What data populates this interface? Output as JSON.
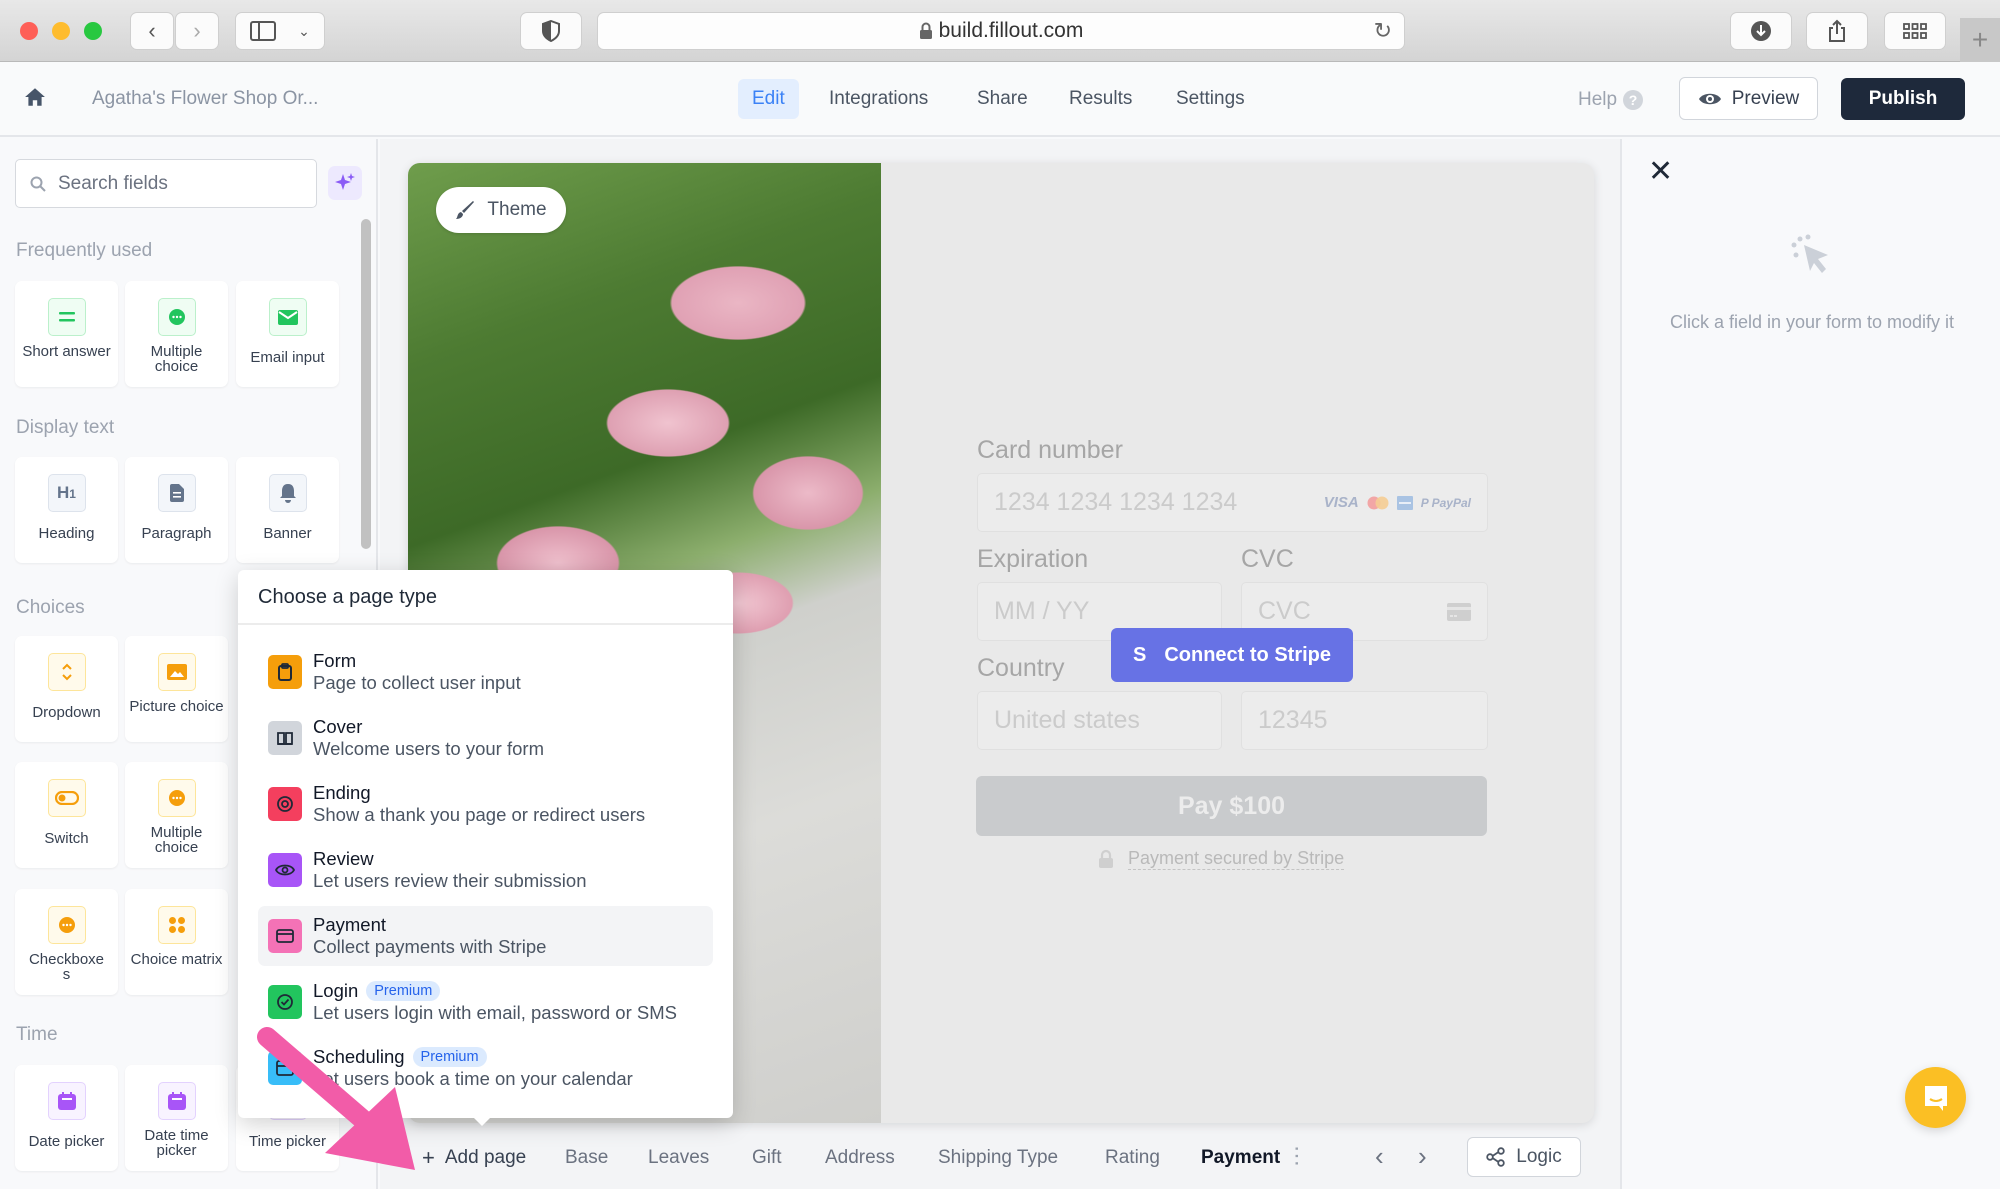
{
  "browser": {
    "url": "build.fillout.com",
    "icons": [
      "back-icon",
      "forward-icon",
      "sidebar-icon",
      "chevron-down-icon",
      "shield-icon",
      "lock-icon",
      "reload-icon",
      "download-icon",
      "share-icon",
      "grid-icon",
      "plus-icon"
    ]
  },
  "header": {
    "form_title": "Agatha's Flower Shop Or...",
    "tabs": [
      {
        "label": "Edit",
        "active": true
      },
      {
        "label": "Integrations",
        "active": false
      },
      {
        "label": "Share",
        "active": false
      },
      {
        "label": "Results",
        "active": false
      },
      {
        "label": "Settings",
        "active": false
      }
    ],
    "help_label": "Help",
    "preview_label": "Preview",
    "publish_label": "Publish",
    "accent_color": "#3b82f6"
  },
  "sidebar": {
    "search_placeholder": "Search fields",
    "sections": [
      {
        "label": "Frequently used",
        "items": [
          {
            "label": "Short answer",
            "icon": "short-answer-icon",
            "color": "#22c55e"
          },
          {
            "label": "Multiple choice",
            "icon": "multiple-choice-icon",
            "color": "#22c55e"
          },
          {
            "label": "Email input",
            "icon": "email-icon",
            "color": "#22c55e"
          }
        ]
      },
      {
        "label": "Display text",
        "items": [
          {
            "label": "Heading",
            "icon": "heading-icon",
            "color": "#64748b"
          },
          {
            "label": "Paragraph",
            "icon": "paragraph-icon",
            "color": "#64748b"
          },
          {
            "label": "Banner",
            "icon": "bell-icon",
            "color": "#64748b"
          }
        ]
      },
      {
        "label": "Choices",
        "items": [
          {
            "label": "Dropdown",
            "icon": "dropdown-icon",
            "color": "#f59e0b"
          },
          {
            "label": "Picture choice",
            "icon": "picture-icon",
            "color": "#f59e0b"
          },
          {
            "label": "Switch",
            "icon": "switch-icon",
            "color": "#f59e0b"
          },
          {
            "label": "Multiple choice",
            "icon": "multiple-choice-icon",
            "color": "#f59e0b"
          },
          {
            "label": "Checkboxes",
            "icon": "checkboxes-icon",
            "color": "#f59e0b"
          },
          {
            "label": "Choice matrix",
            "icon": "matrix-icon",
            "color": "#f59e0b"
          }
        ]
      },
      {
        "label": "Time",
        "items": [
          {
            "label": "Date picker",
            "icon": "calendar-icon",
            "color": "#a855f7"
          },
          {
            "label": "Date time picker",
            "icon": "calendar-icon",
            "color": "#a855f7"
          },
          {
            "label": "Time picker",
            "icon": "calendar-icon",
            "color": "#a855f7"
          }
        ]
      }
    ]
  },
  "canvas": {
    "theme_label": "Theme",
    "payment_form": {
      "card_number_label": "Card number",
      "card_number_placeholder": "1234 1234 1234 1234",
      "card_brands": [
        "VISA",
        "Mastercard",
        "Amex",
        "PayPal"
      ],
      "expiration_label": "Expiration",
      "expiration_placeholder": "MM / YY",
      "cvc_label": "CVC",
      "cvc_placeholder": "CVC",
      "country_label": "Country",
      "country_placeholder": "United states",
      "zip_placeholder": "12345",
      "pay_button": "Pay $100",
      "secured_text": "Payment secured by Stripe"
    },
    "stripe_button": {
      "icon_letter": "S",
      "label": "Connect to Stripe",
      "color": "#6772e5"
    }
  },
  "page_tabs": {
    "add_page_label": "Add page",
    "tabs": [
      {
        "label": "Base",
        "active": false
      },
      {
        "label": "Leaves",
        "active": false
      },
      {
        "label": "Gift",
        "active": false
      },
      {
        "label": "Address",
        "active": false
      },
      {
        "label": "Shipping Type",
        "active": false
      },
      {
        "label": "Rating",
        "active": false
      },
      {
        "label": "Payment",
        "active": true
      }
    ],
    "logic_label": "Logic"
  },
  "popup": {
    "title": "Choose a page type",
    "items": [
      {
        "title": "Form",
        "desc": "Page to collect user input",
        "color": "#f59e0b",
        "icon": "clipboard-icon",
        "badge": null
      },
      {
        "title": "Cover",
        "desc": "Welcome users to your form",
        "color": "#d1d5db",
        "icon": "book-icon",
        "badge": null
      },
      {
        "title": "Ending",
        "desc": "Show a thank you page or redirect users",
        "color": "#f43f5e",
        "icon": "target-icon",
        "badge": null
      },
      {
        "title": "Review",
        "desc": "Let users review their submission",
        "color": "#a855f7",
        "icon": "eye-icon",
        "badge": null
      },
      {
        "title": "Payment",
        "desc": "Collect payments with Stripe",
        "color": "#f472b6",
        "icon": "credit-card-icon",
        "badge": null,
        "hovered": true
      },
      {
        "title": "Login",
        "desc": "Let users login with email, password or SMS",
        "color": "#22c55e",
        "icon": "check-circle-icon",
        "badge": "Premium"
      },
      {
        "title": "Scheduling",
        "desc": "Let users book a time on your calendar",
        "color": "#38bdf8",
        "icon": "calendar-icon",
        "badge": "Premium"
      }
    ]
  },
  "right_panel": {
    "hint": "Click a field in your form to modify it"
  }
}
